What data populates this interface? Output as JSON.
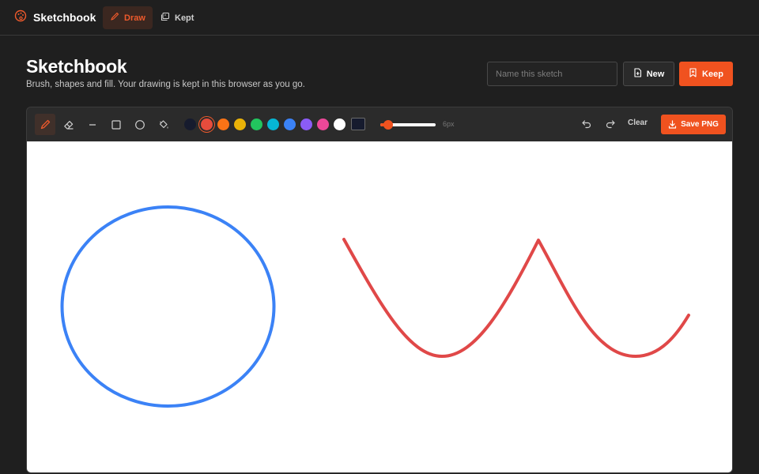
{
  "nav": {
    "brand": "Sketchbook",
    "tabs": [
      {
        "label": "Draw",
        "active": true,
        "icon": "brush-icon"
      },
      {
        "label": "Kept",
        "active": false,
        "icon": "gallery-icon"
      }
    ]
  },
  "header": {
    "title": "Sketchbook",
    "subtitle": "Brush, shapes and fill. Your drawing is kept in this browser as you go.",
    "name_placeholder": "Name this sketch",
    "name_value": "",
    "new_label": "New",
    "keep_label": "Keep"
  },
  "toolbar": {
    "tools": [
      "brush",
      "eraser",
      "line",
      "rectangle",
      "ellipse",
      "fill"
    ],
    "active_tool": "brush",
    "palette": [
      "#161b2e",
      "#e74c3c",
      "#f97316",
      "#eab308",
      "#22c55e",
      "#06b6d4",
      "#3b82f6",
      "#8b5cf6",
      "#ec4899",
      "#ffffff"
    ],
    "selected_color": "#e74c3c",
    "custom_color": "#161b2e",
    "brush_size_label": "6px",
    "brush_size_fraction": 0.07,
    "undo": "undo-icon",
    "redo": "redo-icon",
    "clear_label": "Clear",
    "save_label": "Save PNG"
  },
  "colors": {
    "accent": "#f0521f",
    "stroke_blue": "#3b82f6",
    "stroke_red": "#e04848"
  }
}
